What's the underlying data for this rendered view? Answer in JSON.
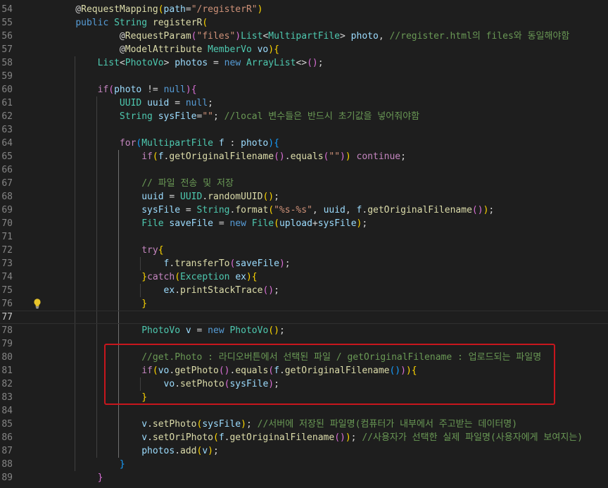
{
  "editor": {
    "active_line": 77,
    "lines": [
      {
        "n": 54,
        "tokens": [
          [
            "t-punc",
            "    @"
          ],
          [
            "t-ann",
            "RequestMapping"
          ],
          [
            "t-brk1",
            "("
          ],
          [
            "t-var",
            "path"
          ],
          [
            "t-punc",
            "="
          ],
          [
            "t-str",
            "\"/registerR\""
          ],
          [
            "t-brk1",
            ")"
          ]
        ]
      },
      {
        "n": 55,
        "tokens": [
          [
            "t-punc",
            "    "
          ],
          [
            "t-kw",
            "public "
          ],
          [
            "t-type",
            "String "
          ],
          [
            "t-fn",
            "registerR"
          ],
          [
            "t-brk1",
            "("
          ]
        ]
      },
      {
        "n": 56,
        "tokens": [
          [
            "t-punc",
            "            @"
          ],
          [
            "t-ann",
            "RequestParam"
          ],
          [
            "t-brk2",
            "("
          ],
          [
            "t-str",
            "\"files\""
          ],
          [
            "t-brk2",
            ")"
          ],
          [
            "t-type",
            "List"
          ],
          [
            "t-punc",
            "<"
          ],
          [
            "t-type",
            "MultipartFile"
          ],
          [
            "t-punc",
            "> "
          ],
          [
            "t-var",
            "photo"
          ],
          [
            "t-punc",
            ", "
          ],
          [
            "t-cmt",
            "//register.html의 files와 동일해야함"
          ]
        ]
      },
      {
        "n": 57,
        "tokens": [
          [
            "t-punc",
            "            @"
          ],
          [
            "t-ann",
            "ModelAttribute "
          ],
          [
            "t-type",
            "MemberVo "
          ],
          [
            "t-var",
            "vo"
          ],
          [
            "t-brk1",
            ")"
          ],
          [
            "t-brk1",
            "{"
          ]
        ]
      },
      {
        "n": 58,
        "tokens": [
          [
            "t-punc",
            "        "
          ],
          [
            "t-type",
            "List"
          ],
          [
            "t-punc",
            "<"
          ],
          [
            "t-type",
            "PhotoVo"
          ],
          [
            "t-punc",
            "> "
          ],
          [
            "t-var",
            "photos"
          ],
          [
            "t-punc",
            " = "
          ],
          [
            "t-kw",
            "new "
          ],
          [
            "t-type",
            "ArrayList"
          ],
          [
            "t-punc",
            "<>"
          ],
          [
            "t-brk2",
            "()"
          ],
          [
            "t-punc",
            ";"
          ]
        ]
      },
      {
        "n": 59,
        "tokens": []
      },
      {
        "n": 60,
        "tokens": [
          [
            "t-punc",
            "        "
          ],
          [
            "t-ctrl",
            "if"
          ],
          [
            "t-brk2",
            "("
          ],
          [
            "t-var",
            "photo"
          ],
          [
            "t-punc",
            " != "
          ],
          [
            "t-kw",
            "null"
          ],
          [
            "t-brk2",
            ")"
          ],
          [
            "t-brk2",
            "{"
          ]
        ]
      },
      {
        "n": 61,
        "tokens": [
          [
            "t-punc",
            "            "
          ],
          [
            "t-type",
            "UUID "
          ],
          [
            "t-var",
            "uuid"
          ],
          [
            "t-punc",
            " = "
          ],
          [
            "t-kw",
            "null"
          ],
          [
            "t-punc",
            ";"
          ]
        ]
      },
      {
        "n": 62,
        "tokens": [
          [
            "t-punc",
            "            "
          ],
          [
            "t-type",
            "String "
          ],
          [
            "t-var",
            "sysFile"
          ],
          [
            "t-punc",
            "="
          ],
          [
            "t-str",
            "\"\""
          ],
          [
            "t-punc",
            "; "
          ],
          [
            "t-cmt",
            "//local 변수들은 반드시 초기값을 넣어줘야함"
          ]
        ]
      },
      {
        "n": 63,
        "tokens": []
      },
      {
        "n": 64,
        "tokens": [
          [
            "t-punc",
            "            "
          ],
          [
            "t-ctrl",
            "for"
          ],
          [
            "t-brk3",
            "("
          ],
          [
            "t-type",
            "MultipartFile "
          ],
          [
            "t-var",
            "f"
          ],
          [
            "t-punc",
            " : "
          ],
          [
            "t-var",
            "photo"
          ],
          [
            "t-brk3",
            ")"
          ],
          [
            "t-brk3",
            "{"
          ]
        ]
      },
      {
        "n": 65,
        "tokens": [
          [
            "t-punc",
            "                "
          ],
          [
            "t-ctrl",
            "if"
          ],
          [
            "t-brk1",
            "("
          ],
          [
            "t-var",
            "f"
          ],
          [
            "t-punc",
            "."
          ],
          [
            "t-fn",
            "getOriginalFilename"
          ],
          [
            "t-brk2",
            "()"
          ],
          [
            "t-punc",
            "."
          ],
          [
            "t-fn",
            "equals"
          ],
          [
            "t-brk2",
            "("
          ],
          [
            "t-str",
            "\"\""
          ],
          [
            "t-brk2",
            ")"
          ],
          [
            "t-brk1",
            ")"
          ],
          [
            "t-punc",
            " "
          ],
          [
            "t-ctrl",
            "continue"
          ],
          [
            "t-punc",
            ";"
          ]
        ]
      },
      {
        "n": 66,
        "tokens": []
      },
      {
        "n": 67,
        "tokens": [
          [
            "t-punc",
            "                "
          ],
          [
            "t-cmt",
            "// 파일 전송 및 저장"
          ]
        ]
      },
      {
        "n": 68,
        "tokens": [
          [
            "t-punc",
            "                "
          ],
          [
            "t-var",
            "uuid"
          ],
          [
            "t-punc",
            " = "
          ],
          [
            "t-type",
            "UUID"
          ],
          [
            "t-punc",
            "."
          ],
          [
            "t-fn",
            "randomUUID"
          ],
          [
            "t-brk1",
            "()"
          ],
          [
            "t-punc",
            ";"
          ]
        ]
      },
      {
        "n": 69,
        "tokens": [
          [
            "t-punc",
            "                "
          ],
          [
            "t-var",
            "sysFile"
          ],
          [
            "t-punc",
            " = "
          ],
          [
            "t-type",
            "String"
          ],
          [
            "t-punc",
            "."
          ],
          [
            "t-fn",
            "format"
          ],
          [
            "t-brk1",
            "("
          ],
          [
            "t-str",
            "\"%s-%s\""
          ],
          [
            "t-punc",
            ", "
          ],
          [
            "t-var",
            "uuid"
          ],
          [
            "t-punc",
            ", "
          ],
          [
            "t-var",
            "f"
          ],
          [
            "t-punc",
            "."
          ],
          [
            "t-fn",
            "getOriginalFilename"
          ],
          [
            "t-brk2",
            "()"
          ],
          [
            "t-brk1",
            ")"
          ],
          [
            "t-punc",
            ";"
          ]
        ]
      },
      {
        "n": 70,
        "tokens": [
          [
            "t-punc",
            "                "
          ],
          [
            "t-type",
            "File "
          ],
          [
            "t-var",
            "saveFile"
          ],
          [
            "t-punc",
            " = "
          ],
          [
            "t-kw",
            "new "
          ],
          [
            "t-type",
            "File"
          ],
          [
            "t-brk1",
            "("
          ],
          [
            "t-var",
            "upload"
          ],
          [
            "t-punc",
            "+"
          ],
          [
            "t-var",
            "sysFile"
          ],
          [
            "t-brk1",
            ")"
          ],
          [
            "t-punc",
            ";"
          ]
        ]
      },
      {
        "n": 71,
        "tokens": []
      },
      {
        "n": 72,
        "tokens": [
          [
            "t-punc",
            "                "
          ],
          [
            "t-ctrl",
            "try"
          ],
          [
            "t-brk1",
            "{"
          ]
        ]
      },
      {
        "n": 73,
        "tokens": [
          [
            "t-punc",
            "                    "
          ],
          [
            "t-var",
            "f"
          ],
          [
            "t-punc",
            "."
          ],
          [
            "t-fn",
            "transferTo"
          ],
          [
            "t-brk2",
            "("
          ],
          [
            "t-var",
            "saveFile"
          ],
          [
            "t-brk2",
            ")"
          ],
          [
            "t-punc",
            ";"
          ]
        ]
      },
      {
        "n": 74,
        "tokens": [
          [
            "t-punc",
            "                "
          ],
          [
            "t-brk1",
            "}"
          ],
          [
            "t-ctrl",
            "catch"
          ],
          [
            "t-brk1",
            "("
          ],
          [
            "t-type",
            "Exception "
          ],
          [
            "t-var",
            "ex"
          ],
          [
            "t-brk1",
            ")"
          ],
          [
            "t-brk1",
            "{"
          ]
        ]
      },
      {
        "n": 75,
        "tokens": [
          [
            "t-punc",
            "                    "
          ],
          [
            "t-var",
            "ex"
          ],
          [
            "t-punc",
            "."
          ],
          [
            "t-fn",
            "printStackTrace"
          ],
          [
            "t-brk2",
            "()"
          ],
          [
            "t-punc",
            ";"
          ]
        ]
      },
      {
        "n": 76,
        "tokens": [
          [
            "t-punc",
            "                "
          ],
          [
            "t-brk1",
            "}"
          ]
        ]
      },
      {
        "n": 77,
        "tokens": []
      },
      {
        "n": 78,
        "tokens": [
          [
            "t-punc",
            "                "
          ],
          [
            "t-type",
            "PhotoVo "
          ],
          [
            "t-var",
            "v"
          ],
          [
            "t-punc",
            " = "
          ],
          [
            "t-kw",
            "new "
          ],
          [
            "t-type",
            "PhotoVo"
          ],
          [
            "t-brk1",
            "()"
          ],
          [
            "t-punc",
            ";"
          ]
        ]
      },
      {
        "n": 79,
        "tokens": []
      },
      {
        "n": 80,
        "tokens": [
          [
            "t-punc",
            "                "
          ],
          [
            "t-cmt",
            "//get.Photo : 라디오버튼에서 선택된 파일 / getOriginalFilename : 업로드되는 파일명"
          ]
        ]
      },
      {
        "n": 81,
        "tokens": [
          [
            "t-punc",
            "                "
          ],
          [
            "t-ctrl",
            "if"
          ],
          [
            "t-brk1",
            "("
          ],
          [
            "t-var",
            "vo"
          ],
          [
            "t-punc",
            "."
          ],
          [
            "t-fn",
            "getPhoto"
          ],
          [
            "t-brk2",
            "()"
          ],
          [
            "t-punc",
            "."
          ],
          [
            "t-fn",
            "equals"
          ],
          [
            "t-brk2",
            "("
          ],
          [
            "t-var",
            "f"
          ],
          [
            "t-punc",
            "."
          ],
          [
            "t-fn",
            "getOriginalFilename"
          ],
          [
            "t-brk3",
            "()"
          ],
          [
            "t-brk2",
            ")"
          ],
          [
            "t-brk1",
            ")"
          ],
          [
            "t-brk1",
            "{"
          ]
        ]
      },
      {
        "n": 82,
        "tokens": [
          [
            "t-punc",
            "                    "
          ],
          [
            "t-var",
            "vo"
          ],
          [
            "t-punc",
            "."
          ],
          [
            "t-fn",
            "setPhoto"
          ],
          [
            "t-brk2",
            "("
          ],
          [
            "t-var",
            "sysFile"
          ],
          [
            "t-brk2",
            ")"
          ],
          [
            "t-punc",
            ";"
          ]
        ]
      },
      {
        "n": 83,
        "tokens": [
          [
            "t-punc",
            "                "
          ],
          [
            "t-brk1",
            "}"
          ]
        ]
      },
      {
        "n": 84,
        "tokens": []
      },
      {
        "n": 85,
        "tokens": [
          [
            "t-punc",
            "                "
          ],
          [
            "t-var",
            "v"
          ],
          [
            "t-punc",
            "."
          ],
          [
            "t-fn",
            "setPhoto"
          ],
          [
            "t-brk1",
            "("
          ],
          [
            "t-var",
            "sysFile"
          ],
          [
            "t-brk1",
            ")"
          ],
          [
            "t-punc",
            "; "
          ],
          [
            "t-cmt",
            "//서버에 저장된 파일명(컴퓨터가 내부에서 주고받는 데이터명)"
          ]
        ]
      },
      {
        "n": 86,
        "tokens": [
          [
            "t-punc",
            "                "
          ],
          [
            "t-var",
            "v"
          ],
          [
            "t-punc",
            "."
          ],
          [
            "t-fn",
            "setOriPhoto"
          ],
          [
            "t-brk1",
            "("
          ],
          [
            "t-var",
            "f"
          ],
          [
            "t-punc",
            "."
          ],
          [
            "t-fn",
            "getOriginalFilename"
          ],
          [
            "t-brk2",
            "()"
          ],
          [
            "t-brk1",
            ")"
          ],
          [
            "t-punc",
            "; "
          ],
          [
            "t-cmt",
            "//사용자가 선택한 실제 파일명(사용자에게 보여지는)"
          ]
        ]
      },
      {
        "n": 87,
        "tokens": [
          [
            "t-punc",
            "                "
          ],
          [
            "t-var",
            "photos"
          ],
          [
            "t-punc",
            "."
          ],
          [
            "t-fn",
            "add"
          ],
          [
            "t-brk1",
            "("
          ],
          [
            "t-var",
            "v"
          ],
          [
            "t-brk1",
            ")"
          ],
          [
            "t-punc",
            ";"
          ]
        ]
      },
      {
        "n": 88,
        "tokens": [
          [
            "t-punc",
            "            "
          ],
          [
            "t-brk3",
            "}"
          ]
        ]
      },
      {
        "n": 89,
        "tokens": [
          [
            "t-punc",
            "        "
          ],
          [
            "t-brk2",
            "}"
          ]
        ]
      }
    ]
  },
  "colors": {
    "background": "#1e1e1e",
    "highlight_box": "#c8161d",
    "bulb": "#e8c52a"
  }
}
